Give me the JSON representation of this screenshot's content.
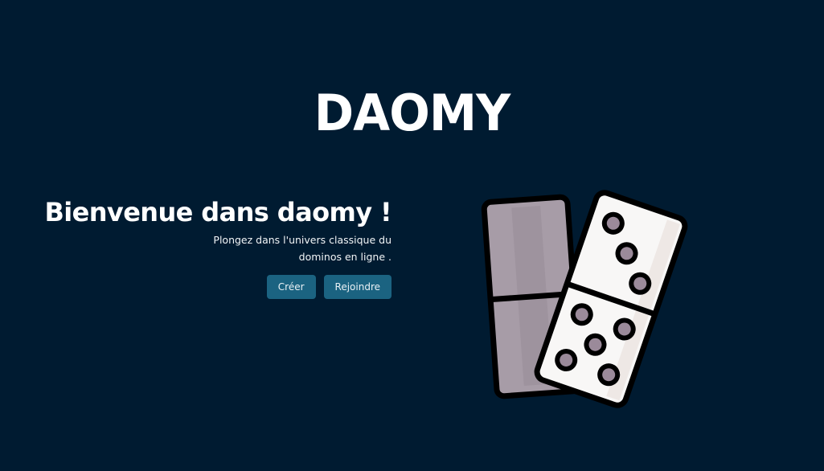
{
  "brand": {
    "logo_text": "DAOMY"
  },
  "hero": {
    "title": "Bienvenue dans daomy !",
    "subtitle": "Plongez dans l'univers classique du dominos en ligne ."
  },
  "actions": {
    "create_label": "Créer",
    "join_label": "Rejoindre"
  },
  "illustration": {
    "icon": "dominoes-icon"
  },
  "colors": {
    "background": "#001b31",
    "button": "#1b6381",
    "text": "#ffffff",
    "domino_back": "#a79ca7",
    "domino_face": "#f8f7f6",
    "pip": "#9b8a9a"
  }
}
